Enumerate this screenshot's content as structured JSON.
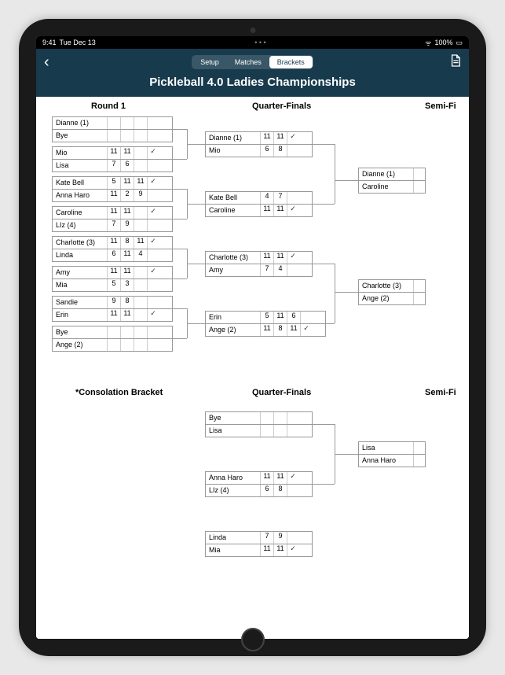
{
  "status": {
    "time": "9:41",
    "date": "Tue Dec 13",
    "signal": "ᯤ",
    "batt": "100%"
  },
  "header": {
    "back": "‹",
    "tabs": [
      "Setup",
      "Matches",
      "Brackets"
    ],
    "active": 2,
    "title": "Pickleball 4.0 Ladies Championships"
  },
  "cols": {
    "r1": "Round 1",
    "qf": "Quarter-Finals",
    "sf": "Semi-Fi",
    "cons": "*Consolation Bracket"
  },
  "checkmark": "✓",
  "r1": [
    {
      "p": [
        {
          "n": "Dianne (1)",
          "s": [
            "",
            "",
            ""
          ]
        },
        {
          "n": "Bye",
          "s": [
            "",
            "",
            ""
          ]
        }
      ],
      "w": null
    },
    {
      "p": [
        {
          "n": "Mio",
          "s": [
            "11",
            "11",
            ""
          ]
        },
        {
          "n": "Lisa",
          "s": [
            "7",
            "6",
            ""
          ]
        }
      ],
      "w": 0
    },
    {
      "p": [
        {
          "n": "Kate Bell",
          "s": [
            "5",
            "11",
            "11"
          ]
        },
        {
          "n": "Anna Haro",
          "s": [
            "11",
            "2",
            "9"
          ]
        }
      ],
      "w": 0
    },
    {
      "p": [
        {
          "n": "Caroline",
          "s": [
            "11",
            "11",
            ""
          ]
        },
        {
          "n": "LIz (4)",
          "s": [
            "7",
            "9",
            ""
          ]
        }
      ],
      "w": 0
    },
    {
      "p": [
        {
          "n": "Charlotte (3)",
          "s": [
            "11",
            "8",
            "11"
          ]
        },
        {
          "n": "Linda",
          "s": [
            "6",
            "11",
            "4"
          ]
        }
      ],
      "w": 0
    },
    {
      "p": [
        {
          "n": "Amy",
          "s": [
            "11",
            "11",
            ""
          ]
        },
        {
          "n": "Mia",
          "s": [
            "5",
            "3",
            ""
          ]
        }
      ],
      "w": 0
    },
    {
      "p": [
        {
          "n": "Sandie",
          "s": [
            "9",
            "8",
            ""
          ]
        },
        {
          "n": "Erin",
          "s": [
            "11",
            "11",
            ""
          ]
        }
      ],
      "w": 1
    },
    {
      "p": [
        {
          "n": "Bye",
          "s": [
            "",
            "",
            ""
          ]
        },
        {
          "n": "Ange (2)",
          "s": [
            "",
            "",
            ""
          ]
        }
      ],
      "w": null
    }
  ],
  "qf": [
    {
      "p": [
        {
          "n": "Dianne (1)",
          "s": [
            "11",
            "11"
          ]
        },
        {
          "n": "Mio",
          "s": [
            "6",
            "8"
          ]
        }
      ],
      "w": 0
    },
    {
      "p": [
        {
          "n": "Kate Bell",
          "s": [
            "4",
            "7"
          ]
        },
        {
          "n": "Caroline",
          "s": [
            "11",
            "11"
          ]
        }
      ],
      "w": 1
    },
    {
      "p": [
        {
          "n": "Charlotte (3)",
          "s": [
            "11",
            "11"
          ]
        },
        {
          "n": "Amy",
          "s": [
            "7",
            "4"
          ]
        }
      ],
      "w": 0
    },
    {
      "p": [
        {
          "n": "Erin",
          "s": [
            "5",
            "11",
            "6"
          ]
        },
        {
          "n": "Ange (2)",
          "s": [
            "11",
            "8",
            "11"
          ]
        }
      ],
      "w": 1
    }
  ],
  "sf": [
    {
      "p": [
        {
          "n": "Dianne (1)"
        },
        {
          "n": "Caroline"
        }
      ]
    },
    {
      "p": [
        {
          "n": "Charlotte (3)"
        },
        {
          "n": "Ange (2)"
        }
      ]
    }
  ],
  "cqf": [
    {
      "p": [
        {
          "n": "Bye",
          "s": [
            "",
            ""
          ]
        },
        {
          "n": "Lisa",
          "s": [
            "",
            ""
          ]
        }
      ],
      "w": null
    },
    {
      "p": [
        {
          "n": "Anna Haro",
          "s": [
            "11",
            "11"
          ]
        },
        {
          "n": "LIz (4)",
          "s": [
            "6",
            "8"
          ]
        }
      ],
      "w": 0
    },
    {
      "p": [
        {
          "n": "Linda",
          "s": [
            "7",
            "9"
          ]
        },
        {
          "n": "Mia",
          "s": [
            "11",
            "11"
          ]
        }
      ],
      "w": 1
    }
  ],
  "csf": [
    {
      "p": [
        {
          "n": "Lisa"
        },
        {
          "n": "Anna Haro"
        }
      ]
    }
  ]
}
